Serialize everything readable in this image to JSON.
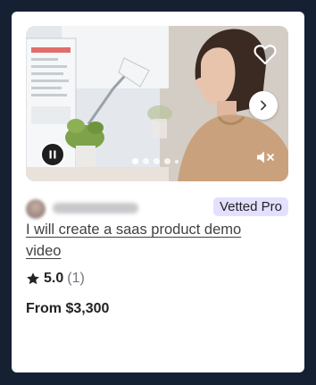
{
  "gig_card": {
    "media": {
      "carousel": {
        "total_slides": 5,
        "active_slide": 1
      },
      "controls": {
        "favorite_icon": "heart-outline-icon",
        "next_icon": "chevron-right-icon",
        "pause_icon": "pause-icon",
        "mute_icon": "speaker-muted-icon"
      }
    },
    "badge": "Vetted Pro",
    "title": "I will create a saas product demo video",
    "rating": {
      "score": "5.0",
      "count": "(1)",
      "icon": "star-icon"
    },
    "price": "From $3,300"
  },
  "colors": {
    "page_background": "#152133",
    "card_background": "#ffffff",
    "badge_background": "#e3e0ff",
    "title_text": "#404145",
    "muted_text": "#74767e",
    "strong_text": "#222325"
  }
}
